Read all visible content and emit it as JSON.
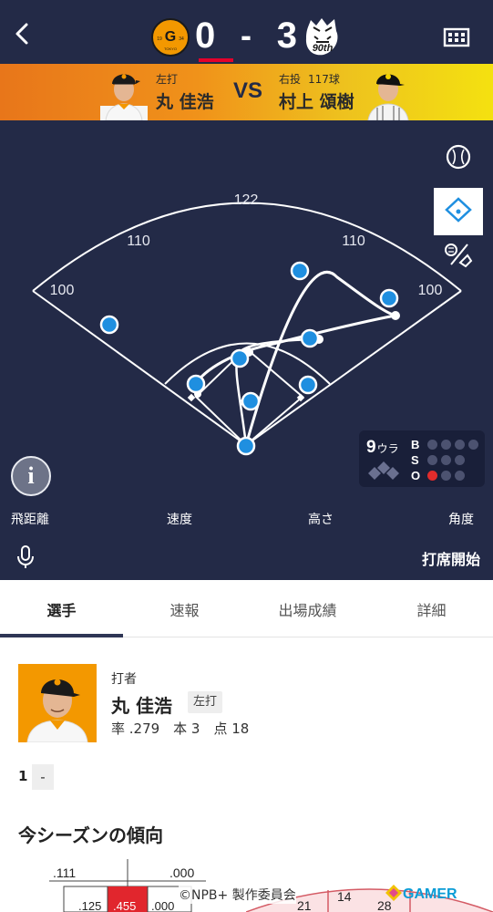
{
  "header": {
    "home_score": "0",
    "score_separator": "-",
    "away_score": "3",
    "home_logo_text": "G",
    "home_logo_year_left": "19",
    "home_logo_year_right": "34",
    "home_logo_bottom": "TOKYO",
    "away_logo_text": "90th"
  },
  "matchup": {
    "batter_hand": "左打",
    "batter_name": "丸 佳浩",
    "vs": "VS",
    "pitcher_hand": "右投",
    "pitch_count": "117球",
    "pitcher_name": "村上 頌樹"
  },
  "field": {
    "distances": {
      "center": "122",
      "left_center": "110",
      "right_center": "110",
      "left": "100",
      "right": "100"
    },
    "inning": "9",
    "inning_half": "ウラ",
    "count": {
      "labels": {
        "balls": "B",
        "strikes": "S",
        "outs": "O"
      },
      "balls": 0,
      "strikes": 0,
      "outs": 1
    }
  },
  "metrics": {
    "distance": "飛距離",
    "speed": "速度",
    "height": "高さ",
    "angle": "角度"
  },
  "actionbar": {
    "start_label": "打席開始"
  },
  "tabs": [
    {
      "label": "選手",
      "active": true
    },
    {
      "label": "速報",
      "active": false
    },
    {
      "label": "出場成績",
      "active": false
    },
    {
      "label": "詳細",
      "active": false
    }
  ],
  "batter": {
    "role": "打者",
    "name": "丸 佳浩",
    "hand": "左打",
    "stats": "率 .279　本 3　点 18"
  },
  "at_bat": {
    "number": "1",
    "result": "-"
  },
  "season": {
    "title": "今シーズンの傾向",
    "zone_top_left": ".111",
    "zone_top_right": ".000",
    "zone_cells": [
      ".125",
      ".455",
      ".000"
    ],
    "spray_values": [
      "21",
      "14",
      "28"
    ]
  },
  "footer": {
    "copyright": "©NPB+ 製作委員会",
    "brand": "GAMER"
  },
  "colors": {
    "navy": "#232a47",
    "marker": "#1f8fe0",
    "banner_start": "#e8761a",
    "banner_end": "#f4e110",
    "out": "#e12c2c"
  }
}
